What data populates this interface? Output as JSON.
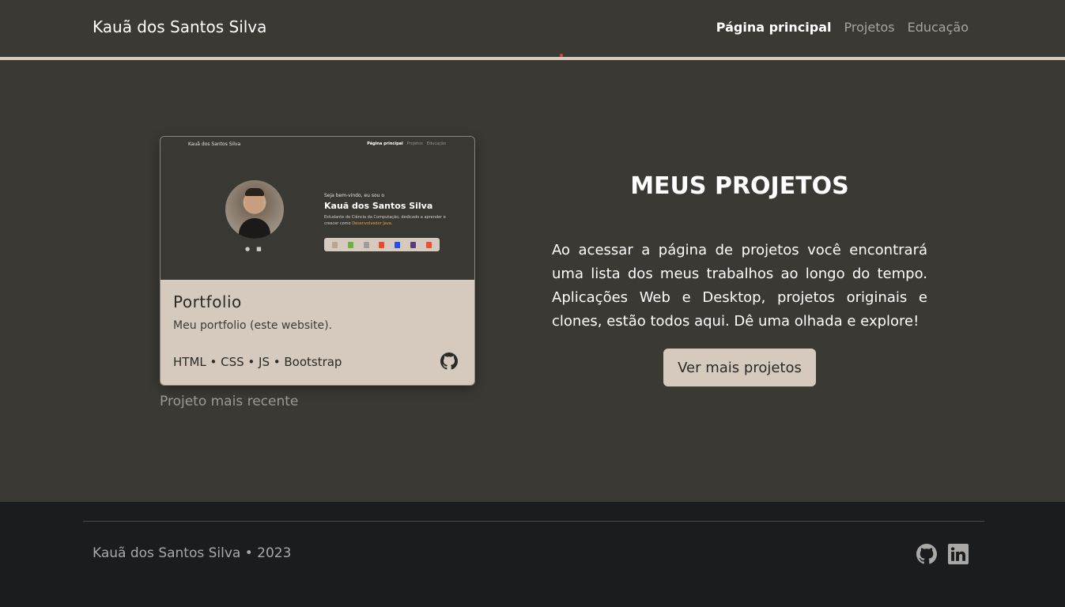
{
  "navbar": {
    "brand": "Kauã dos Santos Silva",
    "links": [
      {
        "label": "Página principal",
        "active": true
      },
      {
        "label": "Projetos",
        "active": false
      },
      {
        "label": "Educação",
        "active": false
      }
    ]
  },
  "card": {
    "thumbnail": {
      "brand": "Kauã dos Santos Silva",
      "nav": [
        "Página principal",
        "Projetos",
        "Educação"
      ],
      "welcome": "Seja bem-vindo, eu sou o",
      "name": "Kauã dos Santos Silva",
      "desc_prefix": "Estudante de Ciência da Computação, dedicado a aprender e crescer como",
      "desc_highlight": "Desenvolvedor Java."
    },
    "title": "Portfolio",
    "text": "Meu portfolio (este website).",
    "tech": "HTML • CSS • JS • Bootstrap",
    "github_icon": "github-icon"
  },
  "recent_label": "Projeto mais recente",
  "projects": {
    "title": "MEUS PROJETOS",
    "text": "Ao acessar a página de projetos você encontrará uma lista dos meus trabalhos ao longo do tempo. Aplicações Web e Desktop, projetos originais e clones, estão todos aqui. Dê uma olhada e explore!",
    "button": "Ver mais projetos"
  },
  "footer": {
    "text": "Kauã dos Santos Silva • 2023",
    "icons": [
      "github-icon",
      "linkedin-icon"
    ]
  },
  "colors": {
    "background": "#3a3934",
    "accent": "#d6c9bd",
    "footer": "#1b1c1e"
  }
}
